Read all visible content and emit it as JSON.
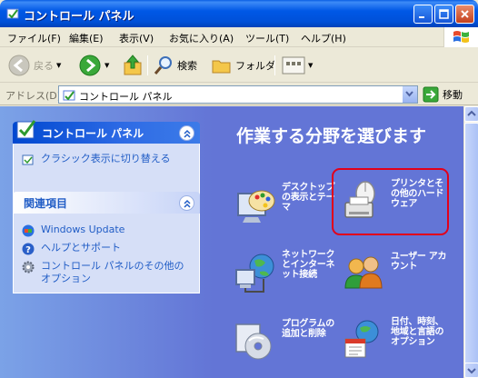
{
  "window": {
    "title": "コントロール パネル"
  },
  "menu": [
    {
      "label": "ファイル(F)"
    },
    {
      "label": "編集(E)"
    },
    {
      "label": "表示(V)"
    },
    {
      "label": "お気に入り(A)"
    },
    {
      "label": "ツール(T)"
    },
    {
      "label": "ヘルプ(H)"
    }
  ],
  "toolbar": {
    "back_label": "戻る",
    "search_label": "検索",
    "folders_label": "フォルダ"
  },
  "address": {
    "label": "アドレス(D)",
    "value": "コントロール パネル",
    "go_label": "移動"
  },
  "taskpane": {
    "main_panel": {
      "title": "コントロール パネル",
      "switch_link": "クラシック表示に切り替える"
    },
    "see_also": {
      "title": "関連項目",
      "links": [
        {
          "label": "Windows Update"
        },
        {
          "label": "ヘルプとサポート"
        },
        {
          "label": "コントロール パネルのその他のオプション"
        }
      ]
    }
  },
  "main": {
    "title": "作業する分野を選びます",
    "categories": [
      {
        "label": "デスクトップの表示とテーマ"
      },
      {
        "label": "プリンタとその他のハードウェア"
      },
      {
        "label": "ネットワークとインターネット接続"
      },
      {
        "label": "ユーザー アカウント"
      },
      {
        "label": "プログラムの追加と削除"
      },
      {
        "label": "日付、時刻、地域と言語のオプション"
      }
    ]
  },
  "colors": {
    "titlebar": "#0058E6",
    "taskpane_bg": "#7BA2E7",
    "main_bg": "#6375D6",
    "link": "#215DC6",
    "highlight": "#E2001A"
  }
}
